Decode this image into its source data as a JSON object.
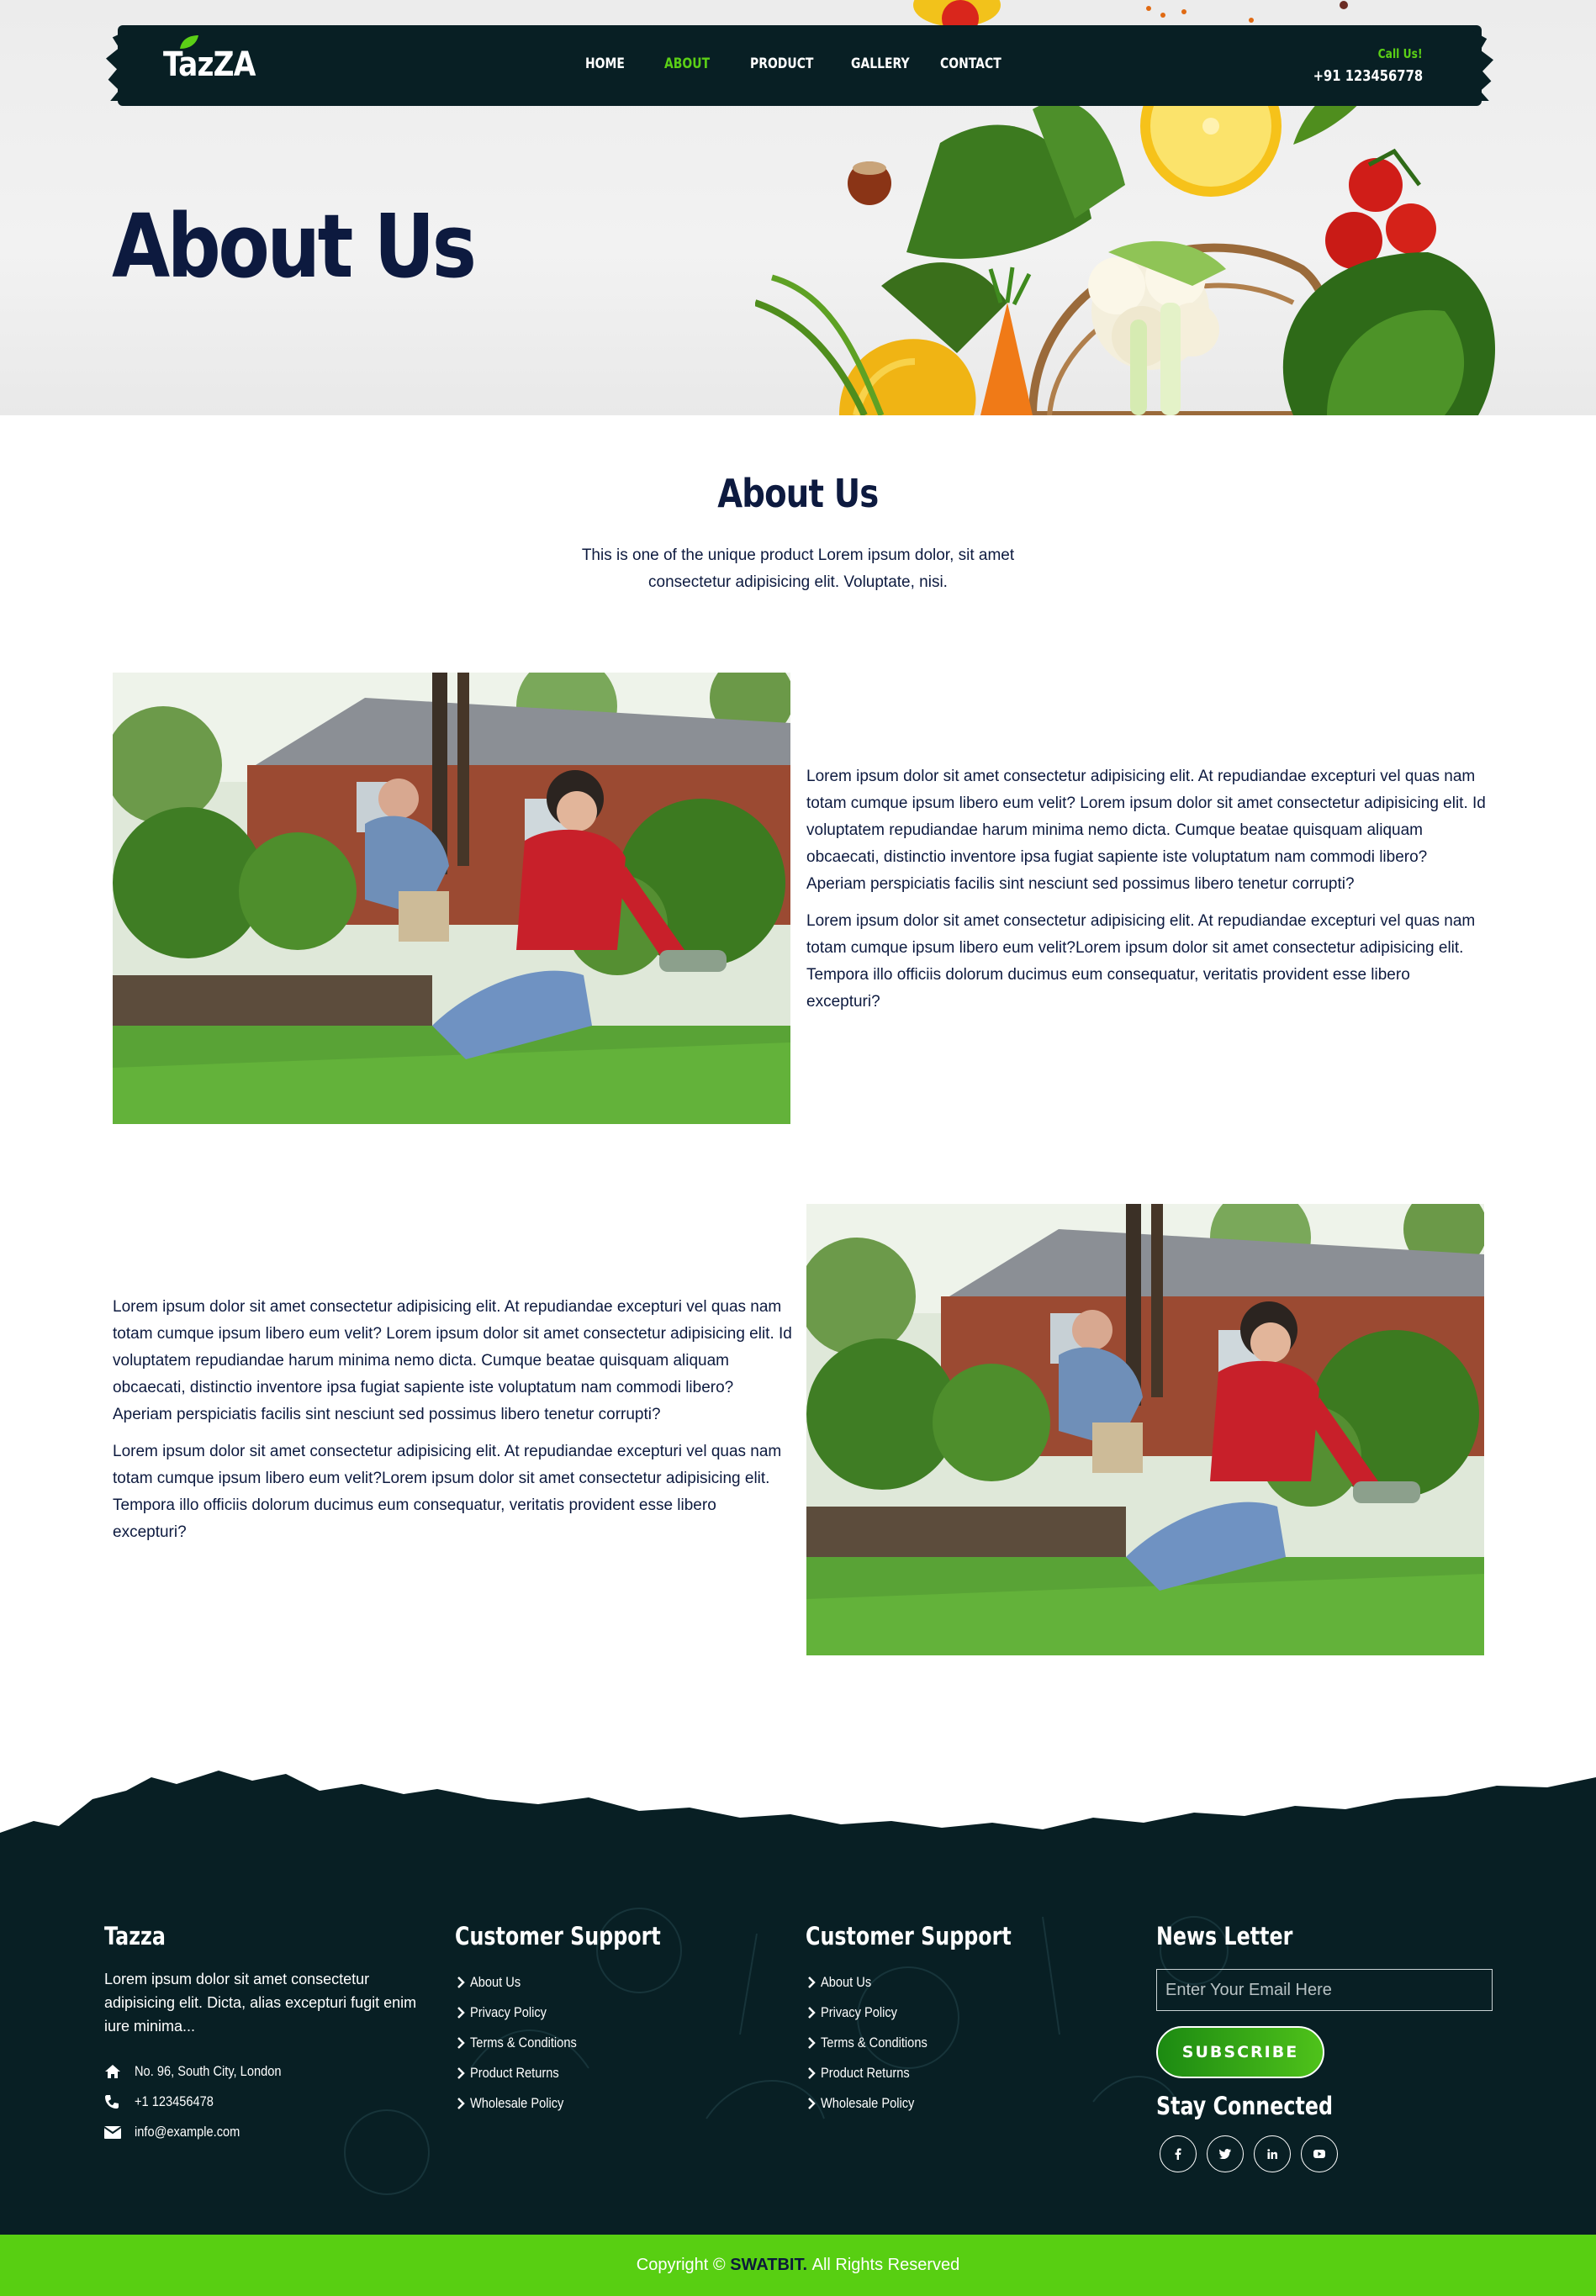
{
  "nav": {
    "logo": "TazZA",
    "items": [
      {
        "label": "HOME",
        "active": false
      },
      {
        "label": "ABOUT",
        "active": true
      },
      {
        "label": "PRODUCT",
        "active": false
      },
      {
        "label": "GALLERY",
        "active": false
      },
      {
        "label": "CONTACT",
        "active": false
      }
    ],
    "call_label": "Call Us!",
    "call_number": "+91 123456778"
  },
  "hero": {
    "title": "About Us"
  },
  "intro": {
    "title": "About Us",
    "subtitle": "This is one of the unique product Lorem ipsum dolor, sit amet consectetur adipisicing elit. Voluptate, nisi."
  },
  "rows": [
    {
      "paragraphs": [
        "Lorem ipsum dolor sit amet consectetur adipisicing elit. At repudiandae excepturi vel quas nam totam cumque ipsum libero eum velit? Lorem ipsum dolor sit amet consectetur adipisicing elit. Id voluptatem repudiandae harum minima nemo dicta. Cumque beatae quisquam aliquam obcaecati, distinctio inventore ipsa fugiat sapiente iste voluptatum nam commodi libero? Aperiam perspiciatis facilis sint nesciunt sed possimus libero tenetur corrupti?",
        "Lorem ipsum dolor sit amet consectetur adipisicing elit. At repudiandae excepturi vel quas nam totam cumque ipsum libero eum velit?Lorem ipsum dolor sit amet consectetur adipisicing elit. Tempora illo officiis dolorum ducimus eum consequatur, veritatis provident esse libero excepturi?"
      ]
    },
    {
      "paragraphs": [
        "Lorem ipsum dolor sit amet consectetur adipisicing elit. At repudiandae excepturi vel quas nam totam cumque ipsum libero eum velit? Lorem ipsum dolor sit amet consectetur adipisicing elit. Id voluptatem repudiandae harum minima nemo dicta. Cumque beatae quisquam aliquam obcaecati, distinctio inventore ipsa fugiat sapiente iste voluptatum nam commodi libero? Aperiam perspiciatis facilis sint nesciunt sed possimus libero tenetur corrupti?",
        "Lorem ipsum dolor sit amet consectetur adipisicing elit. At repudiandae excepturi vel quas nam totam cumque ipsum libero eum velit?Lorem ipsum dolor sit amet consectetur adipisicing elit. Tempora illo officiis dolorum ducimus eum consequatur, veritatis provident esse libero excepturi?"
      ]
    }
  ],
  "footer": {
    "about": {
      "title": "Tazza",
      "description": "Lorem ipsum dolor sit amet consectetur adipisicing elit. Dicta, alias excepturi fugit enim iure minima...",
      "address": "No. 96, South City, London",
      "phone": "+1 123456478",
      "email": "info@example.com"
    },
    "support_1": {
      "title": "Customer Support",
      "links": [
        "About Us",
        "Privacy Policy",
        "Terms & Conditions",
        "Product Returns",
        "Wholesale Policy"
      ]
    },
    "support_2": {
      "title": "Customer Support",
      "links": [
        "About Us",
        "Privacy Policy",
        "Terms & Conditions",
        "Product Returns",
        "Wholesale Policy"
      ]
    },
    "newsletter": {
      "title": "News Letter",
      "placeholder": "Enter Your Email Here",
      "button": "SUBSCRIBE",
      "stay_connected": "Stay Connected",
      "social_icons": [
        "facebook-icon",
        "twitter-icon",
        "linkedin-icon",
        "youtube-icon"
      ]
    },
    "copyright_prefix": "Copyright ©",
    "copyright_brand": "SWATBIT.",
    "copyright_suffix": "All Rights Reserved"
  },
  "colors": {
    "dark": "#081f24",
    "accent_green": "#58cf12",
    "heading_navy": "#0d1a3f"
  }
}
